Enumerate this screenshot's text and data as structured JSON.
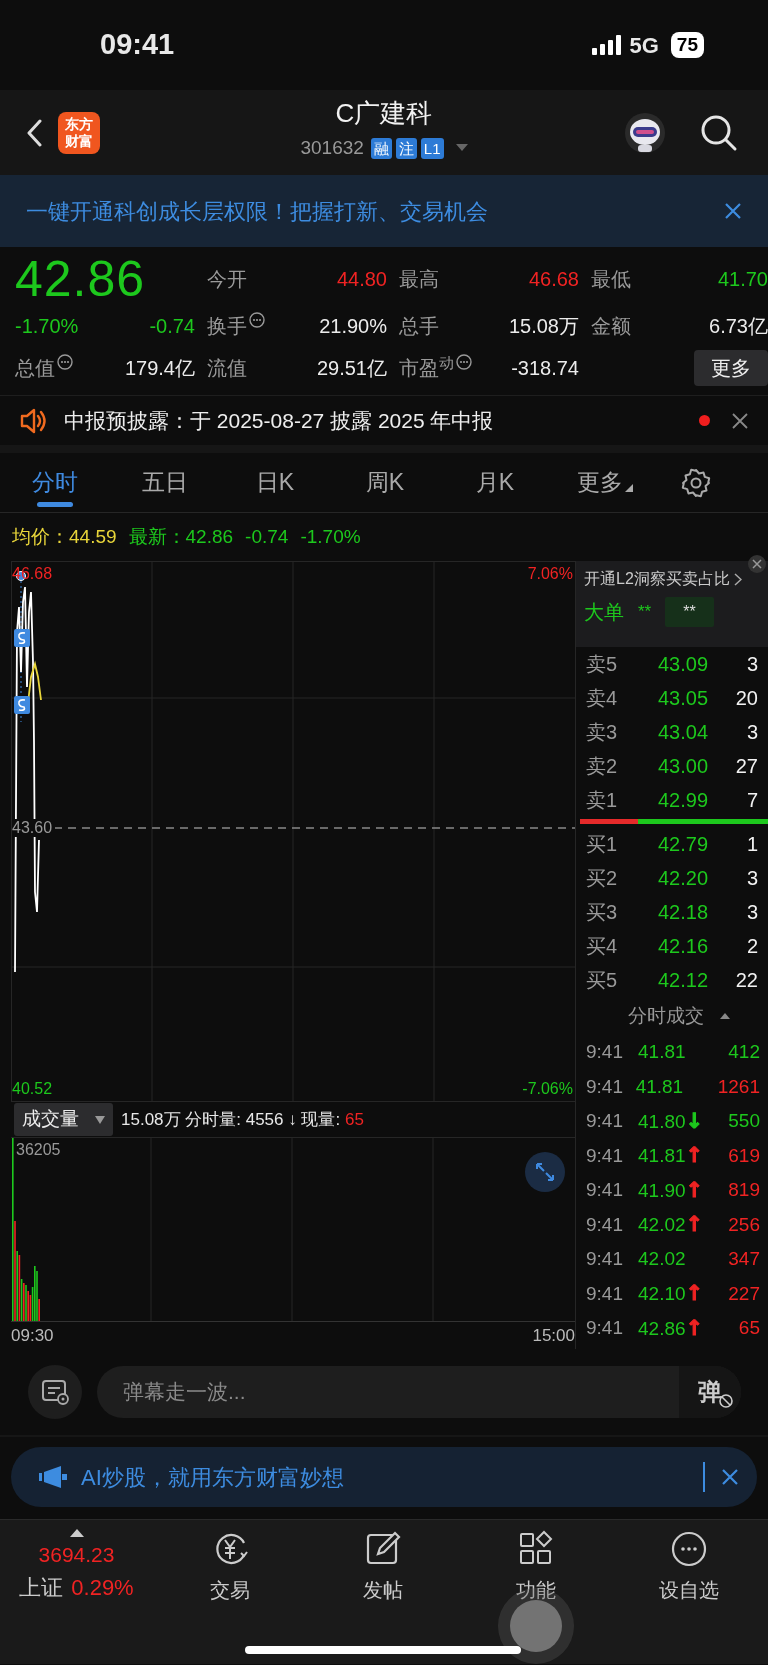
{
  "status_bar": {
    "time": "09:41",
    "network": "5G",
    "battery": "75"
  },
  "header": {
    "logo": [
      "东方",
      "财富"
    ],
    "title": "C广建科",
    "code": "301632",
    "badges": [
      "融",
      "注",
      "L1"
    ]
  },
  "banner": {
    "text": "一键开通科创成长层权限！把握打新、交易机会"
  },
  "quote": {
    "price": "42.86",
    "change_pct": "-1.70%",
    "change": "-0.74",
    "color": "#1dc81d",
    "more_button": "更多",
    "stats": [
      {
        "label": "今开",
        "value": "44.80",
        "color": "#f02323",
        "info": false
      },
      {
        "label": "最高",
        "value": "46.68",
        "color": "#f02323",
        "info": false
      },
      {
        "label": "最低",
        "value": "41.70",
        "color": "#1dc81d",
        "info": false
      },
      {
        "label": "换手",
        "value": "21.90%",
        "color": "#ececec",
        "info": true
      },
      {
        "label": "总手",
        "value": "15.08万",
        "color": "#ececec",
        "info": false
      },
      {
        "label": "金额",
        "value": "6.73亿",
        "color": "#ececec",
        "info": false
      },
      {
        "label": "总值",
        "value": "179.4亿",
        "color": "#ececec",
        "info": true
      },
      {
        "label": "流值",
        "value": "29.51亿",
        "color": "#ececec",
        "info": false
      },
      {
        "label": "市盈$^{动}$",
        "value": "-318.74",
        "color": "#ececec",
        "info": true
      }
    ]
  },
  "notice": {
    "text": "中报预披露：于 2025-08-27 披露 2025 年中报",
    "unread": true
  },
  "chart_tabs": [
    {
      "label": "分时",
      "selected": true,
      "dropdown": false
    },
    {
      "label": "五日",
      "selected": false,
      "dropdown": false
    },
    {
      "label": "日K",
      "selected": false,
      "dropdown": false
    },
    {
      "label": "周K",
      "selected": false,
      "dropdown": false
    },
    {
      "label": "月K",
      "selected": false,
      "dropdown": false
    },
    {
      "label": "更多",
      "selected": false,
      "dropdown": true
    }
  ],
  "summary": {
    "avg_label": "均价：",
    "avg": "44.59",
    "latest_label": "最新：",
    "latest": "42.86",
    "change": "-0.74",
    "change_pct": "-1.70%"
  },
  "price_chart": {
    "high": "46.68",
    "mid": "43.60",
    "low": "40.52",
    "high_pct": "7.06%",
    "low_pct": "-7.06%"
  },
  "volume_chart": {
    "selector": "成交量",
    "total": "15.08万",
    "minute_label": "分时量:",
    "minute_value": "4556",
    "arrow": "↓",
    "current_label": "现量:",
    "current_value": "65",
    "max": "36205",
    "start_time": "09:30",
    "end_time": "15:00"
  },
  "order_book": {
    "l2_promo": "开通L2洞察买卖占比",
    "big_order_label": "大单",
    "big_order_value": "**",
    "big_order_box": "**",
    "asks": [
      {
        "label": "卖5",
        "price": "43.09",
        "volume": "3"
      },
      {
        "label": "卖4",
        "price": "43.05",
        "volume": "20"
      },
      {
        "label": "卖3",
        "price": "43.04",
        "volume": "3"
      },
      {
        "label": "卖2",
        "price": "43.00",
        "volume": "27"
      },
      {
        "label": "卖1",
        "price": "42.99",
        "volume": "7"
      }
    ],
    "balance": {
      "level": 0.31
    },
    "bids": [
      {
        "label": "买1",
        "price": "42.79",
        "volume": "1"
      },
      {
        "label": "买2",
        "price": "42.20",
        "volume": "3"
      },
      {
        "label": "买3",
        "price": "42.18",
        "volume": "3"
      },
      {
        "label": "买4",
        "price": "42.16",
        "volume": "2"
      },
      {
        "label": "买5",
        "price": "42.12",
        "volume": "22"
      }
    ],
    "trades_title": "分时成交",
    "trades": [
      {
        "time": "9:41",
        "price": "41.81",
        "volume": "412",
        "color": "#1dc81d"
      },
      {
        "time": "9:41",
        "price": "41.81",
        "volume": "1261",
        "color": "#f02323"
      },
      {
        "time": "9:41",
        "price": "41.80",
        "arrow": {
          "text": "↓",
          "color": "#1dc81d"
        },
        "volume": "550",
        "color": "#1dc81d"
      },
      {
        "time": "9:41",
        "price": "41.81",
        "arrow": {
          "text": "↑",
          "color": "#f02323"
        },
        "volume": "619",
        "color": "#f02323"
      },
      {
        "time": "9:41",
        "price": "41.90",
        "arrow": {
          "text": "↑",
          "color": "#f02323"
        },
        "volume": "819",
        "color": "#f02323"
      },
      {
        "time": "9:41",
        "price": "42.02",
        "arrow": {
          "text": "↑",
          "color": "#f02323"
        },
        "volume": "256",
        "color": "#f02323"
      },
      {
        "time": "9:41",
        "price": "42.02",
        "volume": "347",
        "color": "#f02323"
      },
      {
        "time": "9:41",
        "price": "42.10",
        "arrow": {
          "text": "↑",
          "color": "#f02323"
        },
        "volume": "227",
        "color": "#f02323"
      },
      {
        "time": "9:41",
        "price": "42.86",
        "arrow": {
          "text": "↑",
          "color": "#f02323"
        },
        "volume": "65",
        "color": "#f02323"
      }
    ]
  },
  "comment_bar": {
    "placeholder": "弹幕走一波...",
    "send_label": "弹"
  },
  "ai_banner": {
    "text": "AI炒股，就用东方财富妙想"
  },
  "bottom_nav": {
    "index": {
      "value": "3694.23",
      "name": "上证",
      "change": "0.29%",
      "color": "#f02323"
    },
    "items": [
      {
        "label": "交易",
        "kind": "trade"
      },
      {
        "label": "发帖",
        "kind": "post"
      },
      {
        "label": "功能",
        "kind": "apps"
      },
      {
        "label": "设自选",
        "kind": "watchlist"
      }
    ]
  }
}
